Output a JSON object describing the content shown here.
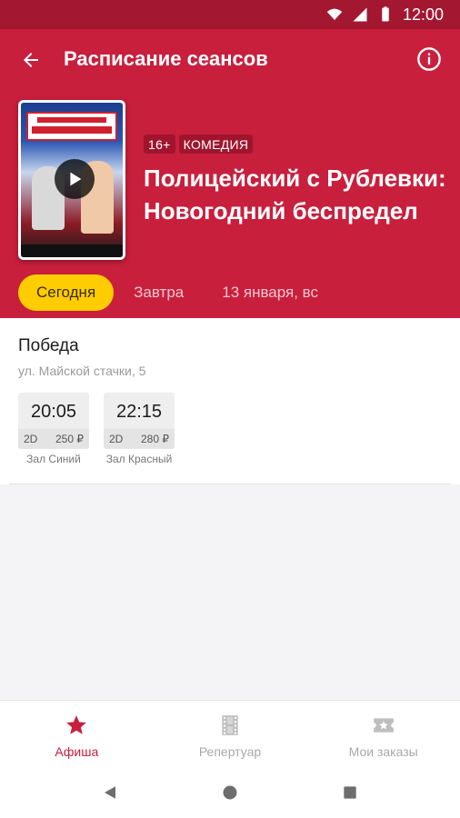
{
  "status_bar": {
    "time": "12:00"
  },
  "appbar": {
    "title": "Расписание сеансов"
  },
  "movie": {
    "age_rating": "16+",
    "genre": "КОМЕДИЯ",
    "title": "Полицейский с Рублевки: Новогодний беспредел"
  },
  "date_tabs": [
    {
      "label": "Сегодня"
    },
    {
      "label": "Завтра"
    },
    {
      "label": "13 января, вс"
    }
  ],
  "cinema": {
    "name": "Победа",
    "address": "ул. Майской стачки, 5",
    "sessions": [
      {
        "time": "20:05",
        "format": "2D",
        "price": "250 ₽",
        "hall": "Зал Синий"
      },
      {
        "time": "22:15",
        "format": "2D",
        "price": "280 ₽",
        "hall": "Зал Красный"
      }
    ]
  },
  "bottom_nav": [
    {
      "label": "Афиша",
      "icon": "star-icon"
    },
    {
      "label": "Репертуар",
      "icon": "film-icon"
    },
    {
      "label": "Мои заказы",
      "icon": "ticket-icon"
    }
  ],
  "colors": {
    "status_bar": "#a41731",
    "header": "#c81f3d",
    "tag": "#a0152d",
    "active_tab": "#ffcc00",
    "accent": "#c81f3d"
  }
}
